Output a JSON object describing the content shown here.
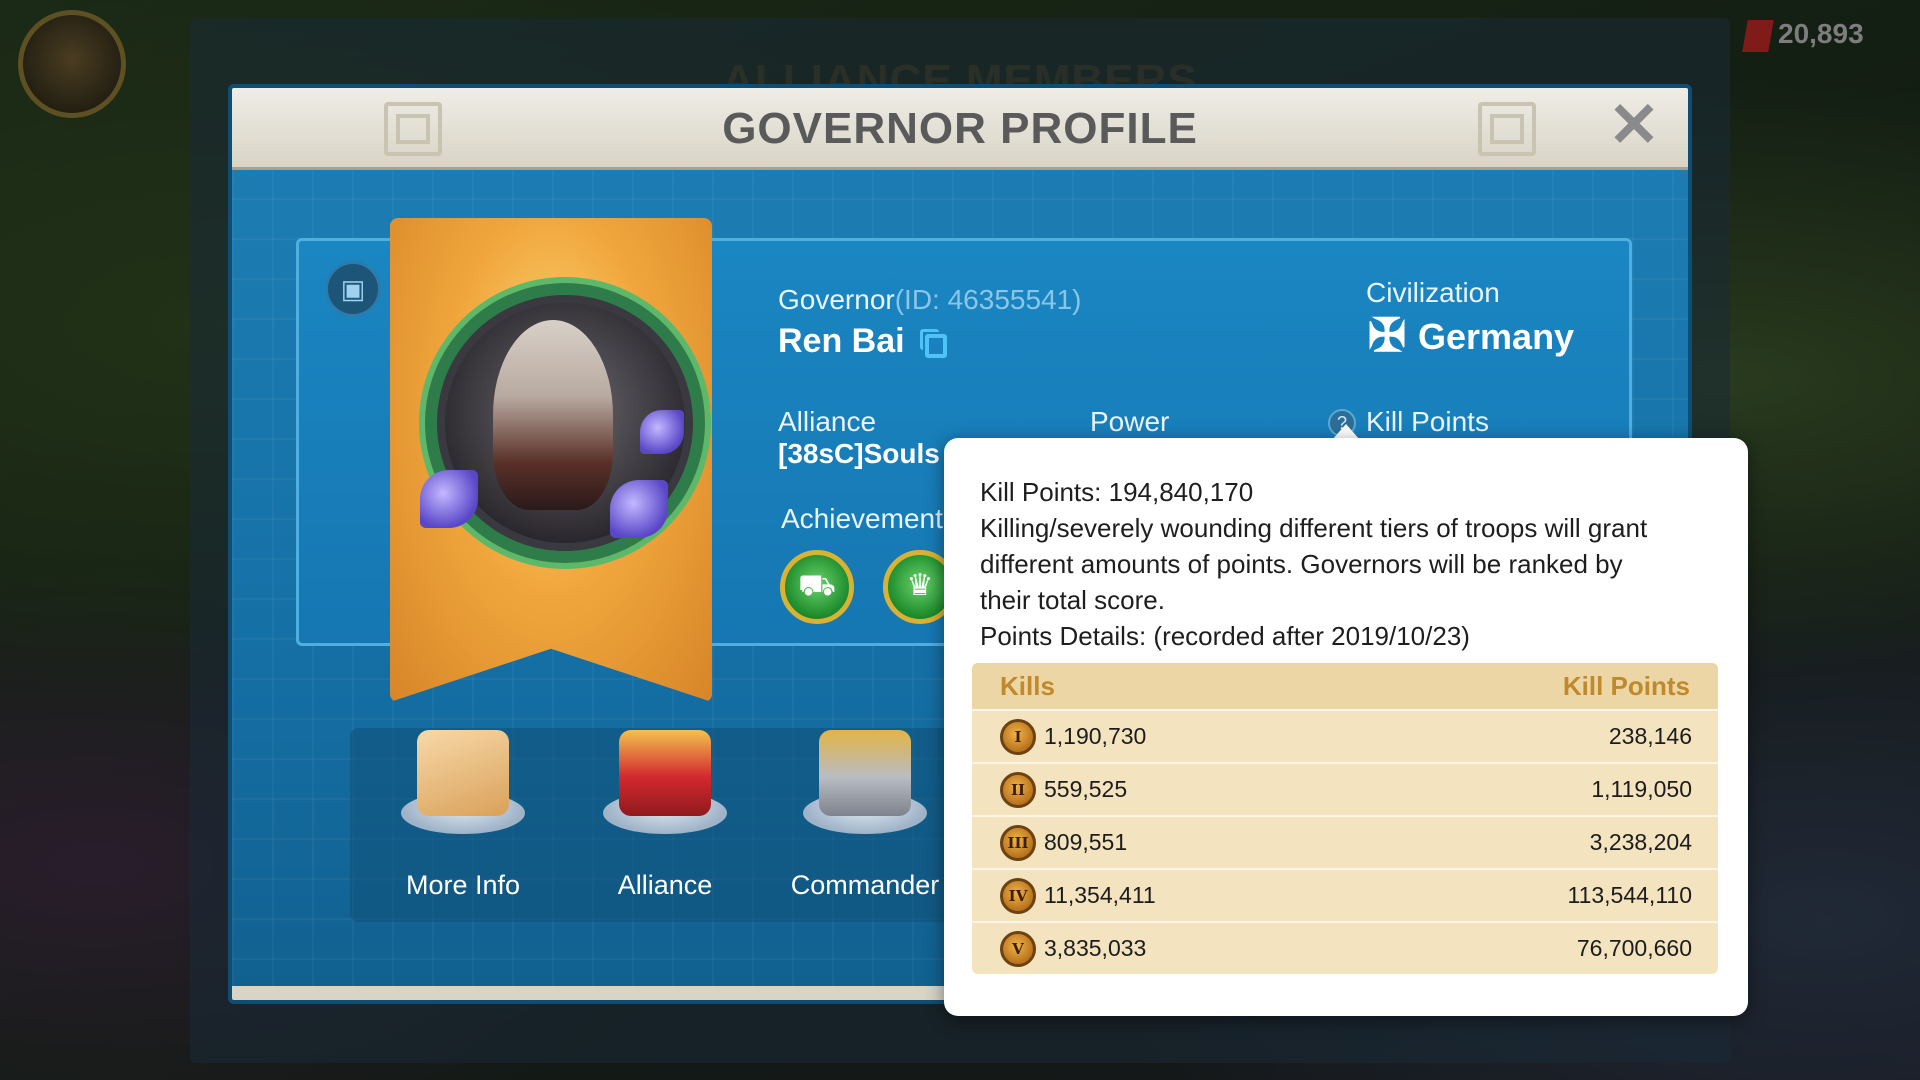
{
  "background": {
    "panel_title": "ALLIANCE MEMBERS",
    "gems": "20,893"
  },
  "dialog": {
    "title": "GOVERNOR PROFILE",
    "close_icon": "close-icon"
  },
  "governor": {
    "label": "Governor",
    "id_text": "(ID: 46355541)",
    "name": "Ren Bai"
  },
  "civilization": {
    "label": "Civilization",
    "name": "Germany",
    "flag_icon": "iron-cross-icon"
  },
  "alliance": {
    "label": "Alliance",
    "value": "[38sC]Souls"
  },
  "power": {
    "label": "Power"
  },
  "kill_points": {
    "label": "Kill Points"
  },
  "achievement": {
    "label": "Achievement",
    "badges": [
      "cart-badge-icon",
      "crown-badge-icon"
    ]
  },
  "actions": [
    {
      "label": "More Info",
      "icon": "scroll-icon"
    },
    {
      "label": "Alliance",
      "icon": "sword-shield-icon"
    },
    {
      "label": "Commander",
      "icon": "helmet-icon"
    }
  ],
  "tooltip": {
    "title": "Kill Points: 194,840,170",
    "description_lines": [
      "Killing/severely wounding different tiers of troops will grant",
      "different amounts of points. Governors will be ranked by",
      "their total score."
    ],
    "details_line": "Points Details: (recorded after 2019/10/23)",
    "table": {
      "headers": {
        "kills": "Kills",
        "points": "Kill Points"
      },
      "rows": [
        {
          "tier": "I",
          "kills": "1,190,730",
          "points": "238,146"
        },
        {
          "tier": "II",
          "kills": "559,525",
          "points": "1,119,050"
        },
        {
          "tier": "III",
          "kills": "809,551",
          "points": "3,238,204"
        },
        {
          "tier": "IV",
          "kills": "11,354,411",
          "points": "113,544,110"
        },
        {
          "tier": "V",
          "kills": "3,835,033",
          "points": "76,700,660"
        }
      ]
    }
  },
  "colors": {
    "dialog_blue": "#1677b2",
    "banner_gold": "#f0a63c",
    "table_header_text": "#c08a2c",
    "table_bg": "#f4e3bf"
  }
}
